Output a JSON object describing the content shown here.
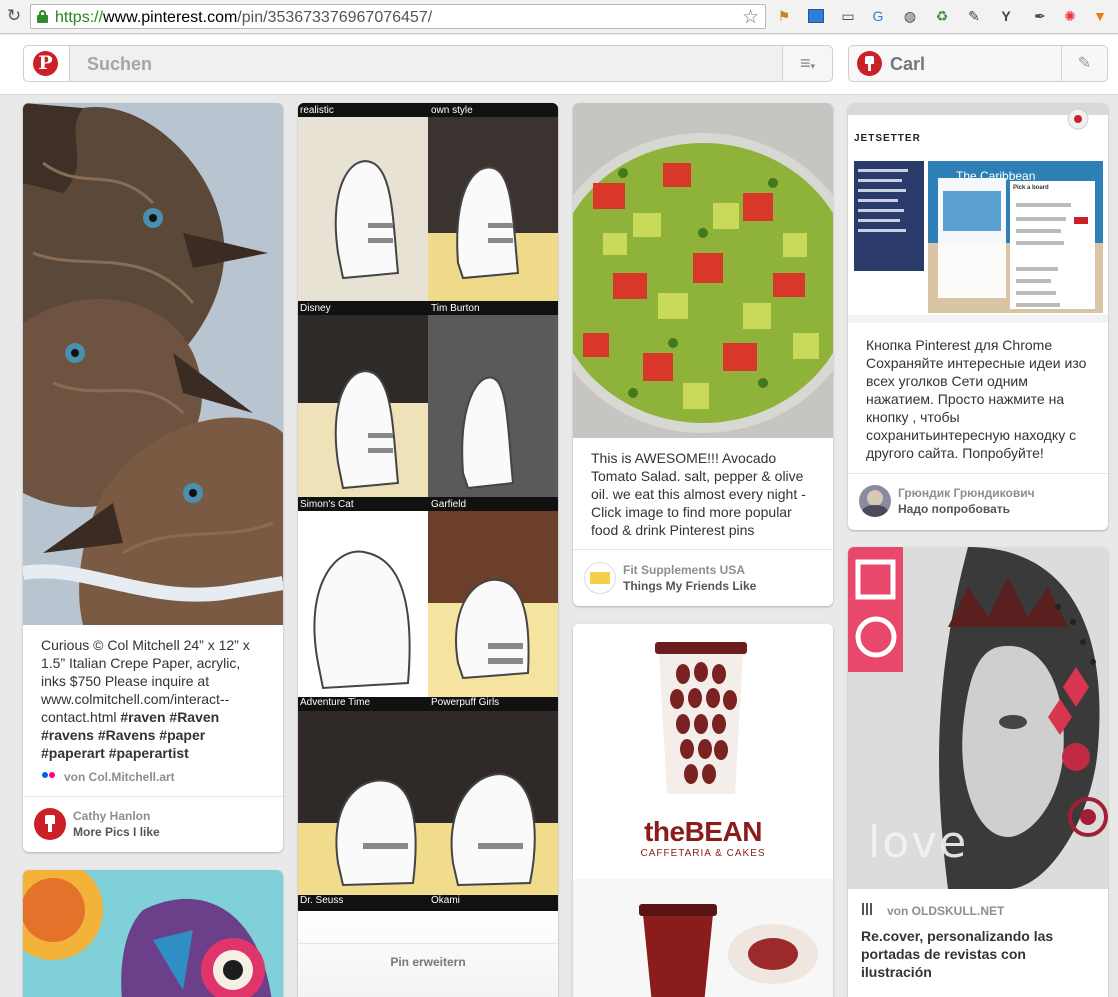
{
  "browser": {
    "url_scheme": "https://",
    "url_host": "www.pinterest.com",
    "url_path": "/pin/353673376967076457/"
  },
  "header": {
    "search_placeholder": "Suchen",
    "user_name": "Carl"
  },
  "pins": {
    "ravens": {
      "description_text": "Curious © Col Mitchell 24” x 12” x 1.5” Italian Crepe Paper, acrylic, inks $750 Please inquire at www.colmitchell.com/interact--contact.html",
      "hashtags": "#raven #Raven #ravens #Ravens #paper #paperart #paperartist",
      "source": "von Col.Mitchell.art",
      "pinner": "Cathy Hanlon",
      "board": "More Pics I like"
    },
    "cats": {
      "labels": [
        "realistic",
        "own style",
        "Disney",
        "Tim Burton",
        "Simon's Cat",
        "Garfield",
        "Adventure Time",
        "Powerpuff Girls",
        "Dr. Seuss",
        "Okami"
      ],
      "expand_button": "Pin erweitern"
    },
    "salad": {
      "description": "This is AWESOME!!! Avocado Tomato Salad. salt, pepper & olive oil. we eat this almost every night - Click image to find more popular food & drink Pinterest pins",
      "pinner": "Fit Supplements USA",
      "board": "Things My Friends Like"
    },
    "bean": {
      "brand": "theBEAN",
      "tagline": "CAFFETARIA & CAKES"
    },
    "chrome": {
      "site_name": "JETSETTER",
      "overlay_title": "The Caribbean",
      "dialog_title": "Pick a board",
      "description": "Кнопка Pinterest для Chrome Сохраняйте интересные идеи изо всех уголков Сети одним нажатием. Просто нажмите на кнопку , чтобы сохранитьинтересную находку с другого сайта. Попробуйте!",
      "pinner": "Грюндик Грюндикович",
      "board": "Надо попробовать"
    },
    "love": {
      "art_word": "love",
      "source": "von OLDSKULL.NET",
      "title": "Re.cover, personalizando las portadas de revistas con ilustración"
    }
  },
  "colors": {
    "pinterest_red": "#cb2027"
  }
}
